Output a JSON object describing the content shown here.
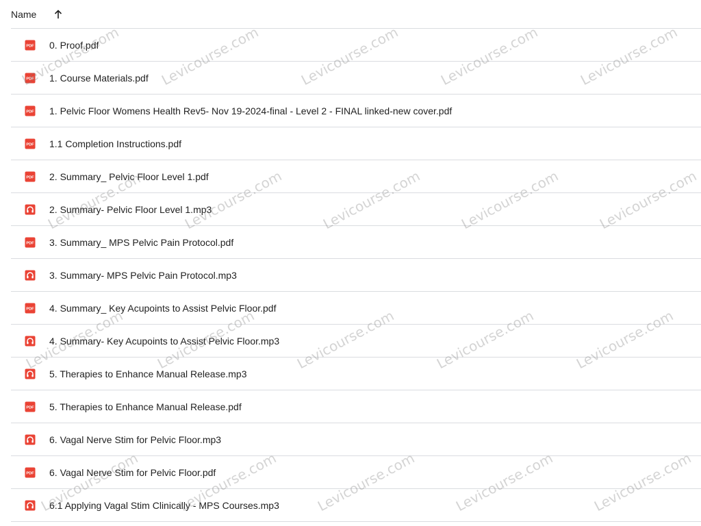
{
  "header": {
    "name_label": "Name",
    "sort_icon": "arrow-up-icon"
  },
  "colors": {
    "pdf_red": "#ea4335",
    "audio_red": "#ea4335",
    "divider": "#dadce0",
    "text": "#1f1f1f"
  },
  "files": [
    {
      "type": "pdf",
      "name": "0. Proof.pdf"
    },
    {
      "type": "pdf",
      "name": "1. Course Materials.pdf"
    },
    {
      "type": "pdf",
      "name": "1. Pelvic Floor Womens Health Rev5- Nov 19-2024-final - Level 2 - FINAL linked-new cover.pdf"
    },
    {
      "type": "pdf",
      "name": "1.1 Completion Instructions.pdf"
    },
    {
      "type": "pdf",
      "name": "2. Summary_ Pelvic Floor Level 1.pdf"
    },
    {
      "type": "audio",
      "name": "2. Summary- Pelvic Floor Level 1.mp3"
    },
    {
      "type": "pdf",
      "name": "3. Summary_ MPS Pelvic Pain Protocol.pdf"
    },
    {
      "type": "audio",
      "name": "3. Summary- MPS Pelvic Pain Protocol.mp3"
    },
    {
      "type": "pdf",
      "name": "4. Summary_ Key Acupoints to Assist Pelvic Floor.pdf"
    },
    {
      "type": "audio",
      "name": "4. Summary- Key Acupoints to Assist Pelvic Floor.mp3"
    },
    {
      "type": "audio",
      "name": "5. Therapies to Enhance Manual Release.mp3"
    },
    {
      "type": "pdf",
      "name": "5. Therapies to Enhance Manual Release.pdf"
    },
    {
      "type": "audio",
      "name": "6. Vagal Nerve Stim for Pelvic Floor.mp3"
    },
    {
      "type": "pdf",
      "name": "6. Vagal Nerve Stim for Pelvic Floor.pdf"
    },
    {
      "type": "audio",
      "name": "6.1 Applying Vagal Stim Clinically - MPS Courses.mp3"
    }
  ],
  "watermark": {
    "text": "Levicourse.com"
  }
}
